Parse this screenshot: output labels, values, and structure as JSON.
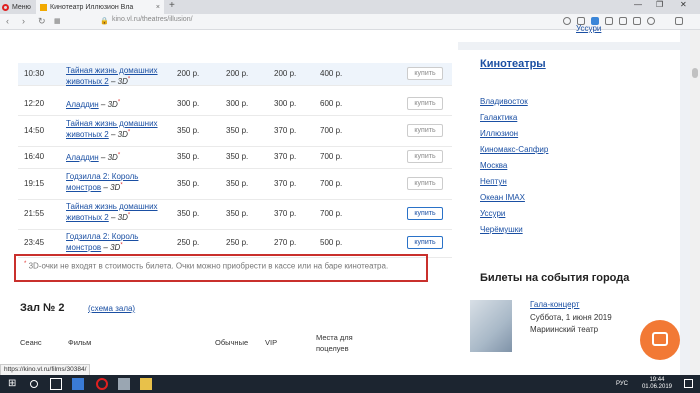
{
  "browser": {
    "menu_label": "Меню",
    "tab_title": "Кинотеатр Иллюзион Вла",
    "tab_close": "×",
    "newtab": "+",
    "url": "kino.vl.ru/theatres/illusion/",
    "status_url": "https://kino.vl.ru/films/30384/"
  },
  "sessions": [
    {
      "time": "10:30",
      "film": "Тайная жизнь домашних",
      "film2": "животных 2",
      "suffix": "– 3D",
      "p1": "200 р.",
      "p2": "200 р.",
      "p3": "200 р.",
      "p4": "400 р.",
      "buy": "купить",
      "active": false
    },
    {
      "time": "12:20",
      "film": "Аладдин",
      "film2": "",
      "suffix": "– 3D",
      "p1": "300 р.",
      "p2": "300 р.",
      "p3": "300 р.",
      "p4": "600 р.",
      "buy": "купить",
      "active": false
    },
    {
      "time": "14:50",
      "film": "Тайная жизнь домашних",
      "film2": "животных 2",
      "suffix": "– 3D",
      "p1": "350 р.",
      "p2": "350 р.",
      "p3": "370 р.",
      "p4": "700 р.",
      "buy": "купить",
      "active": false
    },
    {
      "time": "16:40",
      "film": "Аладдин",
      "film2": "",
      "suffix": "– 3D",
      "p1": "350 р.",
      "p2": "350 р.",
      "p3": "370 р.",
      "p4": "700 р.",
      "buy": "купить",
      "active": false
    },
    {
      "time": "19:15",
      "film": "Годзилла 2: Король",
      "film2": "монстров",
      "suffix": "– 3D",
      "p1": "350 р.",
      "p2": "350 р.",
      "p3": "370 р.",
      "p4": "700 р.",
      "buy": "купить",
      "active": false
    },
    {
      "time": "21:55",
      "film": "Тайная жизнь домашних",
      "film2": "животных 2",
      "suffix": "– 3D",
      "p1": "350 р.",
      "p2": "350 р.",
      "p3": "370 р.",
      "p4": "700 р.",
      "buy": "купить",
      "active": true
    },
    {
      "time": "23:45",
      "film": "Годзилла 2: Король",
      "film2": "монстров",
      "suffix": "– 3D",
      "p1": "250 р.",
      "p2": "250 р.",
      "p3": "270 р.",
      "p4": "500 р.",
      "buy": "купить",
      "active": true
    }
  ],
  "star": "*",
  "note": "3D-очки не входят в стоимость билета. Очки можно приобрести в кассе или на баре кинотеатра.",
  "hall": {
    "title": "Зал № 2",
    "scheme_link": "(схема зала)",
    "headers": {
      "session": "Сеанс",
      "film": "Фильм",
      "regular": "Обычные",
      "vip": "VIP",
      "couples": "Места для",
      "couples2": "поцелуев"
    }
  },
  "sidebar": {
    "ghost_link": "Уссури",
    "cinemas_title": "Кинотеатры",
    "cinemas": [
      "Владивосток",
      "Галактика",
      "Иллюзион",
      "Киномакс-Сапфир",
      "Москва",
      "Нептун",
      "Океан IMAX",
      "Уссури",
      "Черёмушки"
    ],
    "events_title": "Билеты на события города",
    "event": {
      "name": "Гала-концерт",
      "date": "Суббота, 1 июня 2019",
      "place": "Мариинский театр"
    }
  },
  "taskbar": {
    "lang": "РУС",
    "time": "19:44",
    "date": "01.06.2019"
  },
  "colors": {
    "link": "#1a4fa3",
    "note_border": "#c9302c",
    "chat": "#f27935",
    "taskbar": "#1c2530"
  }
}
